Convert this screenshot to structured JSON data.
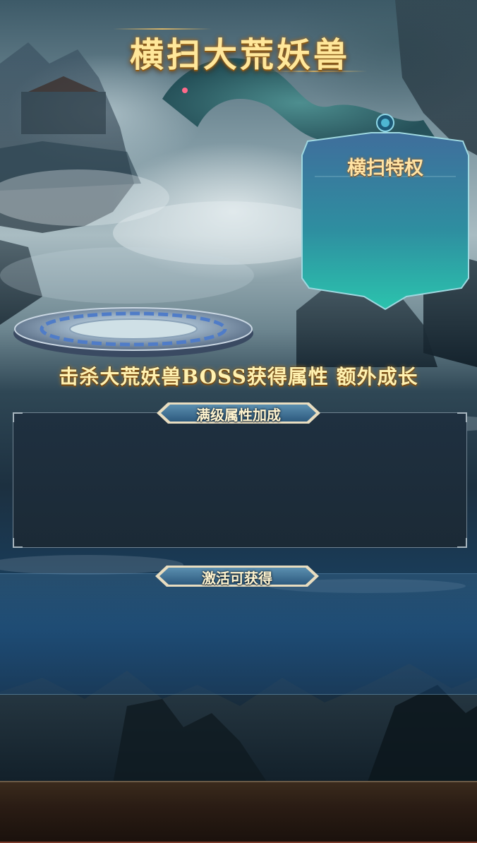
{
  "title": "横扫大荒妖兽",
  "privilege_panel": {
    "title": "横扫特权"
  },
  "kill_banner": "击杀大荒妖兽BOSS获得属性 额外成长",
  "attribute_section": {
    "title": "满级属性加成"
  },
  "activate_section": {
    "title": "激活可获得"
  },
  "colors": {
    "gold_text": "#ffe79a",
    "panel_teal": "#2fb6a8",
    "panel_blue": "#3f74a2",
    "dark_panel": "#1b2a36"
  }
}
